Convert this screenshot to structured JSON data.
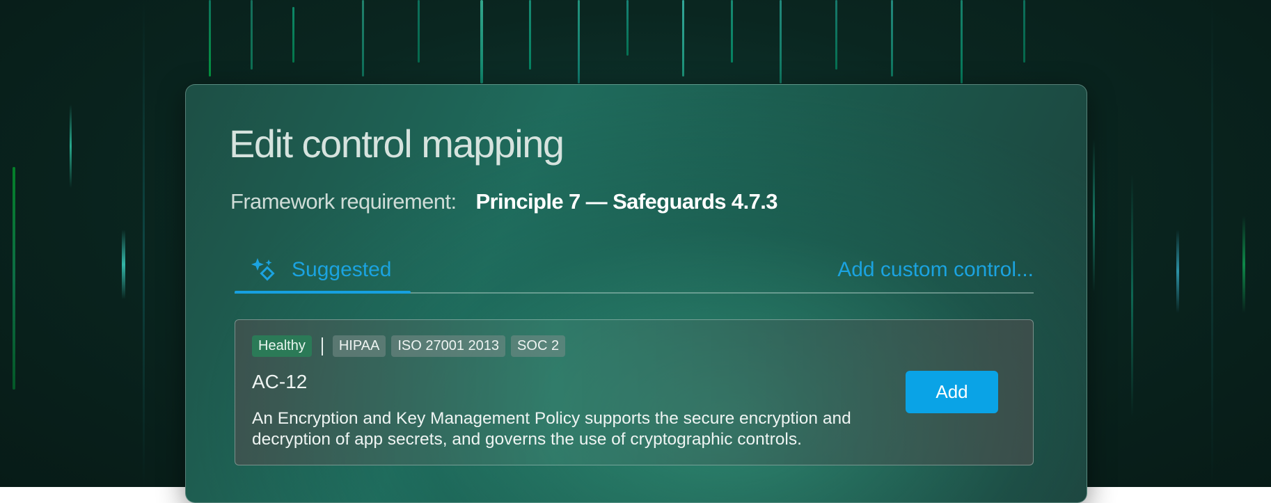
{
  "dialog": {
    "title": "Edit control mapping",
    "framework_label": "Framework requirement:",
    "framework_value": "Principle 7 — Safeguards 4.7.3"
  },
  "tabs": {
    "suggested_label": "Suggested",
    "suggested_icon": "sparkle-icon",
    "add_custom_label": "Add custom control..."
  },
  "card": {
    "status_badge": "Healthy",
    "framework_badges": [
      "HIPAA",
      "ISO 27001 2013",
      "SOC 2"
    ],
    "control_id": "AC-12",
    "description": "An Encryption and Key Management Policy supports the secure encryption and decryption of app secrets, and governs the use of cryptographic controls.",
    "add_button_label": "Add"
  },
  "colors": {
    "accent": "#0aa3e6",
    "healthy": "#2b7a57"
  }
}
